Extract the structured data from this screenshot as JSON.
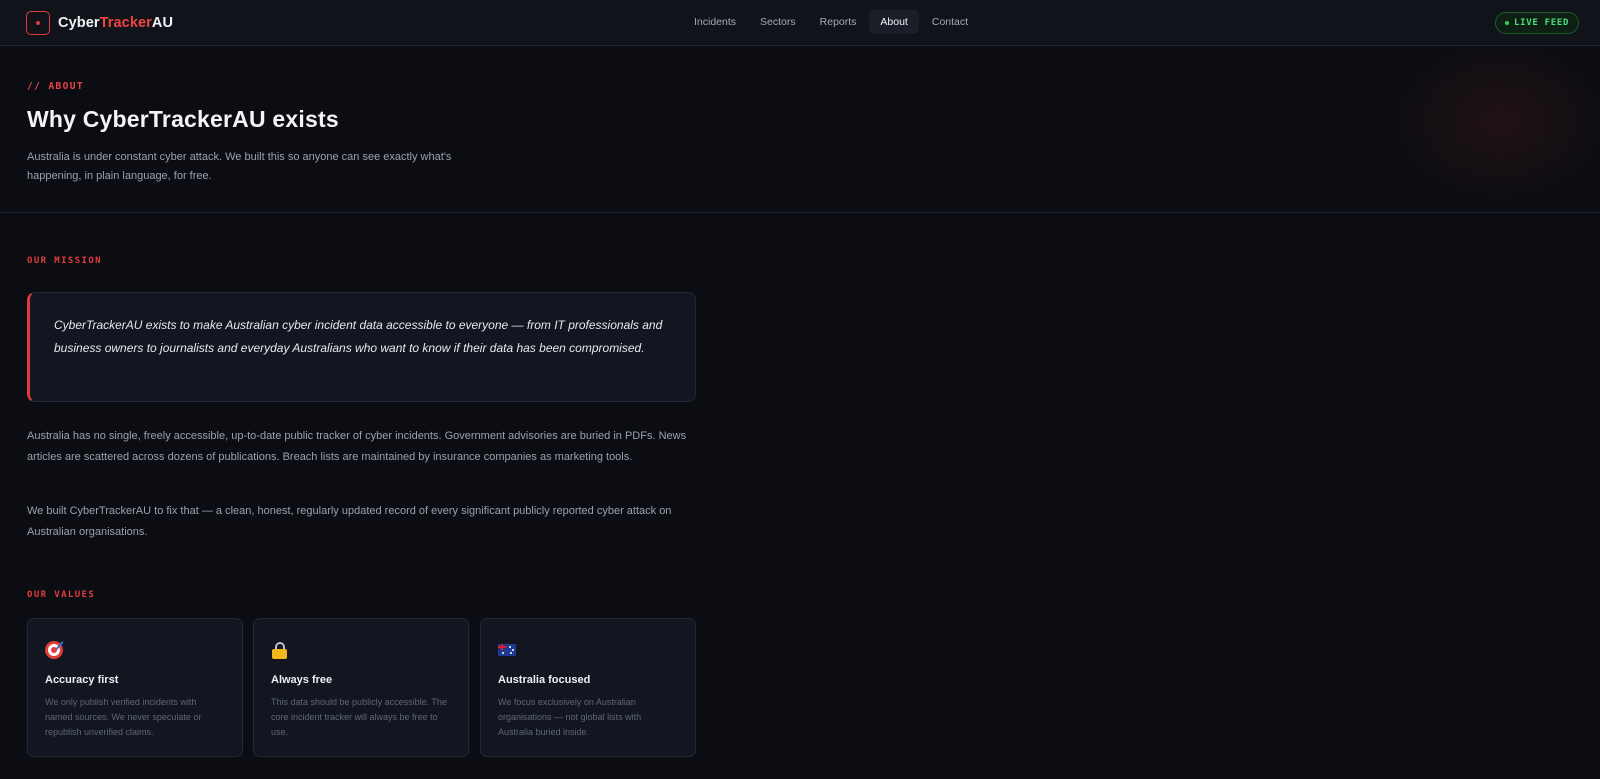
{
  "brand": {
    "name_part1": "Cyber",
    "name_part2": "Tracker",
    "name_part3": "AU"
  },
  "nav": {
    "links": [
      "Incidents",
      "Sectors",
      "Reports",
      "About",
      "Contact"
    ],
    "active": "About"
  },
  "live_feed": "LIVE FEED",
  "hero": {
    "eyebrow": "// ABOUT",
    "title": "Why CyberTrackerAU exists",
    "subtitle": "Australia is under constant cyber attack. We built this so anyone can see exactly what's happening, in plain language, for free."
  },
  "mission": {
    "label": "OUR MISSION",
    "quote": "CyberTrackerAU exists to make Australian cyber incident data accessible to everyone — from IT professionals and business owners to journalists and everyday Australians who want to know if their data has been compromised.",
    "paragraphs": [
      "Australia has no single, freely accessible, up-to-date public tracker of cyber incidents. Government advisories are buried in PDFs. News articles are scattered across dozens of publications. Breach lists are maintained by insurance companies as marketing tools.",
      "We built CyberTrackerAU to fix that — a clean, honest, regularly updated record of every significant publicly reported cyber attack on Australian organisations."
    ]
  },
  "values": {
    "label": "OUR VALUES",
    "cards": [
      {
        "icon": "target-icon",
        "title": "Accuracy first",
        "desc": "We only publish verified incidents with named sources. We never speculate or republish unverified claims."
      },
      {
        "icon": "lock-icon",
        "title": "Always free",
        "desc": "This data should be publicly accessible. The core incident tracker will always be free to use."
      },
      {
        "icon": "australia-flag-icon",
        "title": "Australia focused",
        "desc": "We focus exclusively on Australian organisations — not global lists with Australia buried inside."
      }
    ]
  },
  "colors": {
    "accent": "#ef4444",
    "live": "#4ade80",
    "background": "#0b0d12",
    "card": "#121620"
  }
}
